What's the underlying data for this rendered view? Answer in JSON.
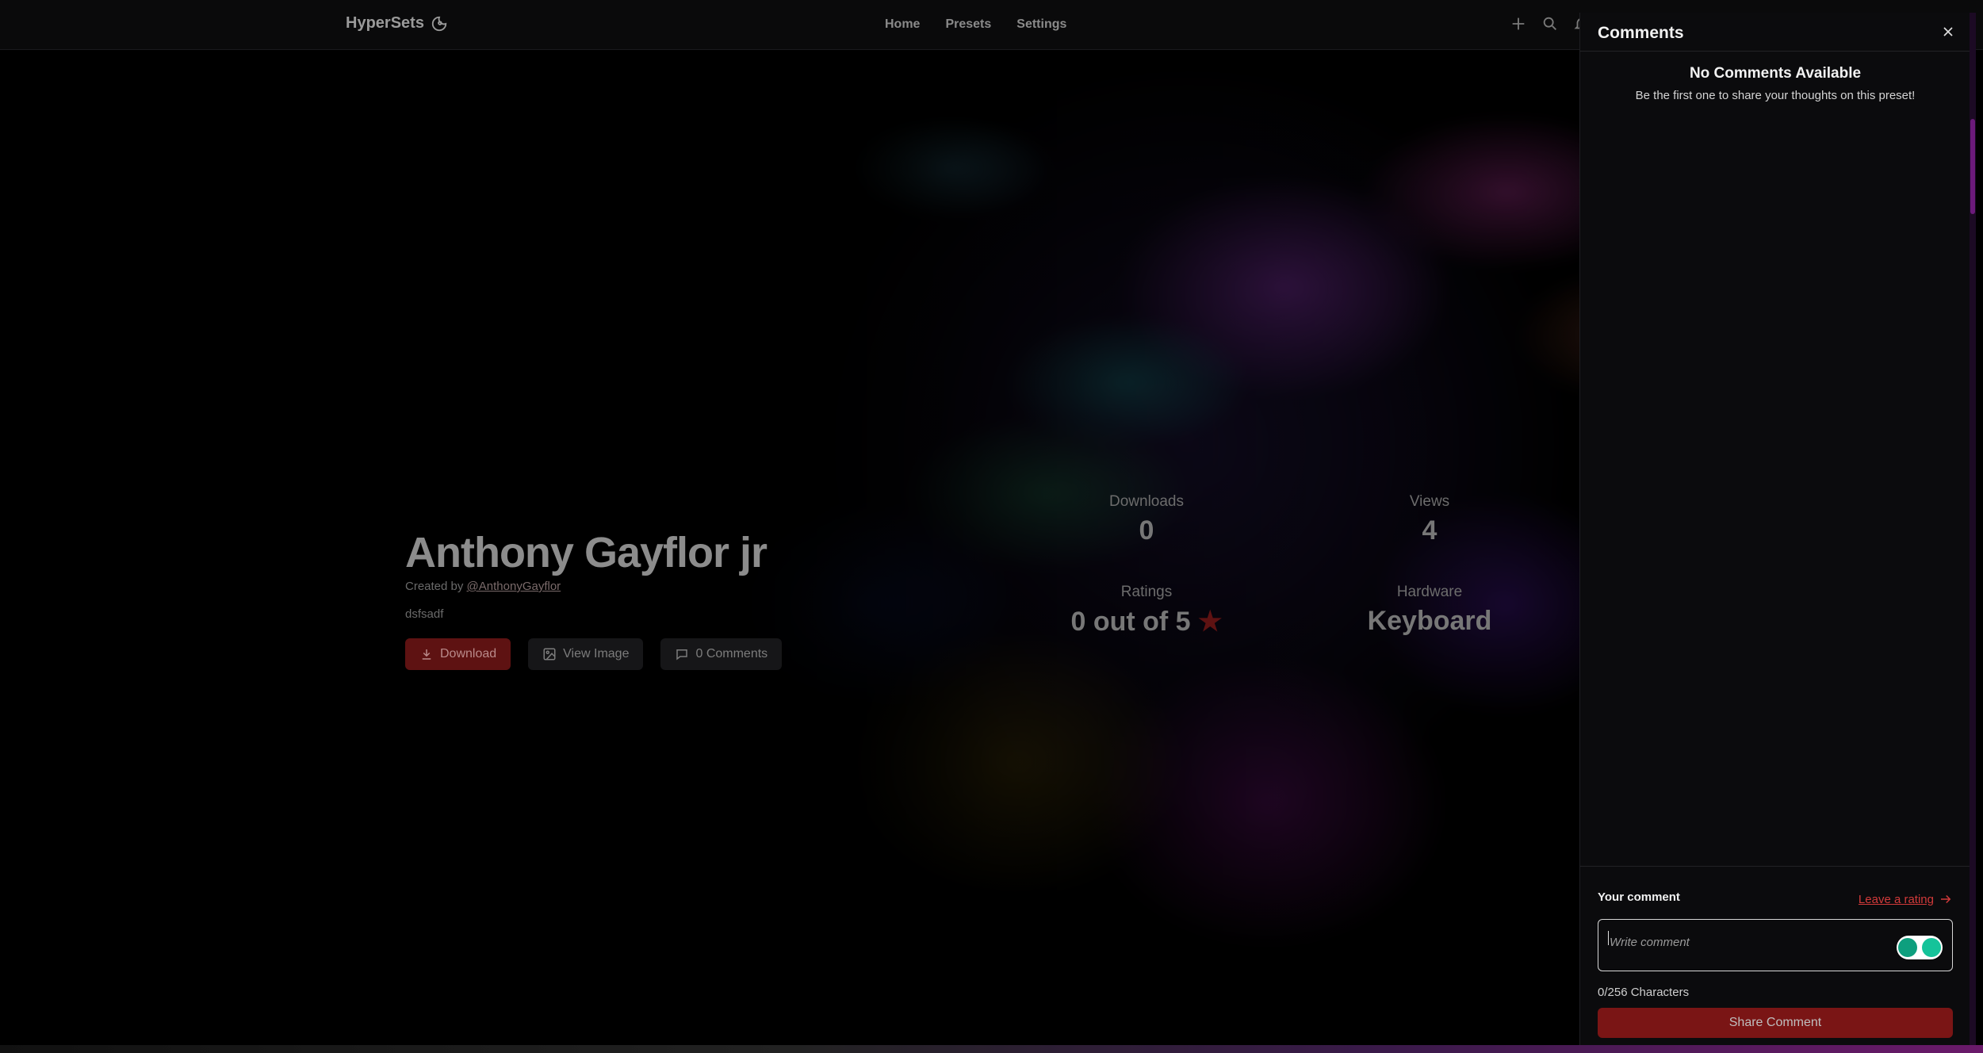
{
  "nav": {
    "brand": "HyperSets",
    "links": [
      "Home",
      "Presets",
      "Settings"
    ]
  },
  "preset": {
    "title": "Anthony Gayflor jr",
    "created_by_prefix": "Created by ",
    "author": "@AnthonyGayflor",
    "description": "dsfsadf",
    "download_label": "Download",
    "view_image_label": "View Image",
    "comments_label": "0 Comments"
  },
  "stats": {
    "downloads_label": "Downloads",
    "downloads_value": "0",
    "views_label": "Views",
    "views_value": "4",
    "ratings_label": "Ratings",
    "ratings_value": "0 out of 5",
    "hardware_label": "Hardware",
    "hardware_value": "Keyboard"
  },
  "drawer": {
    "title": "Comments",
    "empty_title": "No Comments Available",
    "empty_subtitle": "Be the first one to share your thoughts on this preset!",
    "your_comment_label": "Your comment",
    "leave_rating_label": "Leave a rating",
    "comment_placeholder": "Write comment",
    "comment_value": "",
    "char_count": "0/256 Characters",
    "share_button": "Share Comment"
  },
  "colors": {
    "accent": "#7a1515",
    "link": "#d23a3a",
    "background": "#000000",
    "drawer_bg": "#0b0b0d"
  },
  "icons": [
    "logo-icon",
    "plus-icon",
    "search-icon",
    "bell-icon",
    "download-icon",
    "image-icon",
    "comment-icon",
    "star-icon",
    "close-icon",
    "arrow-right-icon",
    "grammarly-icon"
  ]
}
